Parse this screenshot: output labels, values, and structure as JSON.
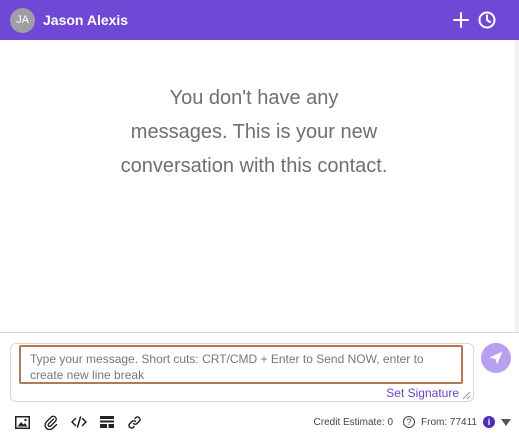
{
  "header": {
    "avatar_initials": "JA",
    "contact_name": "Jason Alexis",
    "accent_color": "#7048d6"
  },
  "conversation": {
    "empty_message": "You don't have any messages. This is your new conversation with this contact."
  },
  "composer": {
    "placeholder": "Type your message. Short cuts: CRT/CMD + Enter to Send NOW, enter to create new line break",
    "value": "",
    "set_signature_label": "Set Signature"
  },
  "toolbar": {
    "icons": [
      "image-icon",
      "paperclip-icon",
      "code-icon",
      "template-icon",
      "link-icon"
    ]
  },
  "footer": {
    "credit_label": "Credit Estimate:",
    "credit_value": "0",
    "from_label": "From:",
    "from_value": "77411",
    "help_glyph": "?",
    "info_glyph": "i"
  }
}
